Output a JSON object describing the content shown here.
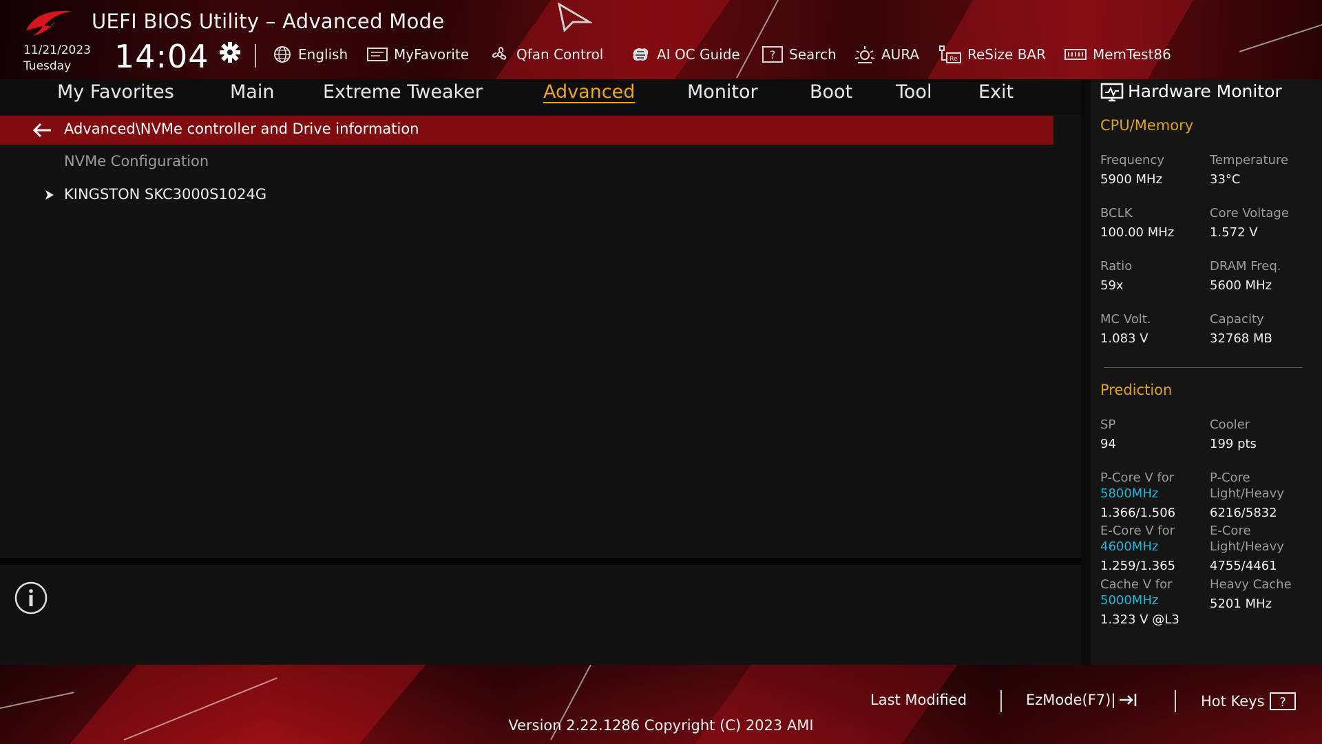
{
  "colors": {
    "accent": "#f0a21c",
    "selection_bar": "#800c10",
    "cyan": "#22b5d5",
    "brand_red": "#c8141e"
  },
  "header": {
    "title": "UEFI BIOS Utility – Advanced Mode",
    "date": "11/21/2023",
    "day": "Tuesday",
    "time": "14:04",
    "tools": [
      {
        "label": "English",
        "icon": "globe-icon"
      },
      {
        "label": "MyFavorite",
        "icon": "favorite-icon"
      },
      {
        "label": "Qfan Control",
        "icon": "fan-icon"
      },
      {
        "label": "AI OC Guide",
        "icon": "ai-oc-icon"
      },
      {
        "label": "Search",
        "icon": "search-icon"
      },
      {
        "label": "AURA",
        "icon": "aura-icon"
      },
      {
        "label": "ReSize BAR",
        "icon": "resize-bar-icon"
      },
      {
        "label": "MemTest86",
        "icon": "memtest-icon"
      }
    ]
  },
  "tabs": [
    "My Favorites",
    "Main",
    "Extreme Tweaker",
    "Advanced",
    "Monitor",
    "Boot",
    "Tool",
    "Exit"
  ],
  "active_tab": "Advanced",
  "main": {
    "breadcrumb": "Advanced\\NVMe controller and Drive information",
    "section_label": "NVMe Configuration",
    "items": [
      "KINGSTON SKC3000S1024G"
    ]
  },
  "hardware_monitor": {
    "title": "Hardware Monitor",
    "cpu_memory": {
      "heading": "CPU/Memory",
      "frequency_label": "Frequency",
      "frequency": "5900 MHz",
      "temperature_label": "Temperature",
      "temperature": "33°C",
      "bclk_label": "BCLK",
      "bclk": "100.00 MHz",
      "core_voltage_label": "Core Voltage",
      "core_voltage": "1.572 V",
      "ratio_label": "Ratio",
      "ratio": "59x",
      "dram_freq_label": "DRAM Freq.",
      "dram_freq": "5600 MHz",
      "mc_volt_label": "MC Volt.",
      "mc_volt": "1.083 V",
      "capacity_label": "Capacity",
      "capacity": "32768 MB"
    },
    "prediction": {
      "heading": "Prediction",
      "sp_label": "SP",
      "sp": "94",
      "cooler_label": "Cooler",
      "cooler": "199 pts",
      "pcore_v_label": "P-Core V for",
      "pcore_v_freq": "5800MHz",
      "pcore_v": "1.366/1.506",
      "pcore_lh_label1": "P-Core",
      "pcore_lh_label2": "Light/Heavy",
      "pcore_lh": "6216/5832",
      "ecore_v_label": "E-Core V for",
      "ecore_v_freq": "4600MHz",
      "ecore_v": "1.259/1.365",
      "ecore_lh_label1": "E-Core",
      "ecore_lh_label2": "Light/Heavy",
      "ecore_lh": "4755/4461",
      "cache_v_label": "Cache V for",
      "cache_v_freq": "5000MHz",
      "cache_v": "1.323 V @L3",
      "heavy_cache_label": "Heavy Cache",
      "heavy_cache": "5201 MHz"
    }
  },
  "footer": {
    "last_modified": "Last Modified",
    "ezmode": "EzMode(F7)|",
    "hotkeys": "Hot Keys",
    "version": "Version 2.22.1286 Copyright (C) 2023 AMI"
  }
}
